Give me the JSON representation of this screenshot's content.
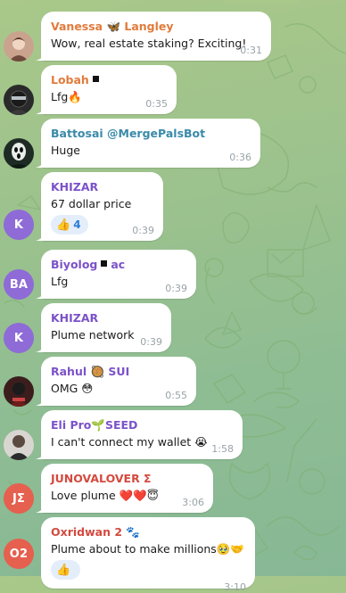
{
  "messages": [
    {
      "sender": "Vanessa 🦋 Langley",
      "text": "Wow, real estate staking? Exciting!",
      "time": "0:31",
      "avatar": "photo",
      "name_color": "#e17b3c"
    },
    {
      "sender": "Lobah",
      "text": "Lfg🔥",
      "time": "0:35",
      "avatar": "photo",
      "name_color": "#e17b3c"
    },
    {
      "sender": "Battosai @MergePalsBot",
      "text": "Huge",
      "time": "0:36",
      "avatar": "photo",
      "name_color": "#3a8aa8"
    },
    {
      "sender": "KHIZAR",
      "text": "67 dollar price",
      "time": "0:39",
      "avatar": "K",
      "avatar_color": "#8e6bd6",
      "name_color": "#7b52c8",
      "reaction": {
        "emoji": "👍",
        "count": "4"
      }
    },
    {
      "sender": "Biyolog",
      "sender_suffix": "ac",
      "text": "Lfg",
      "time": "0:39",
      "avatar": "BA",
      "avatar_color": "#8e6bd6",
      "name_color": "#7b52c8"
    },
    {
      "sender": "KHIZAR",
      "text": "Plume network",
      "time": "0:39",
      "avatar": "K",
      "avatar_color": "#8e6bd6",
      "name_color": "#7b52c8"
    },
    {
      "sender": "Rahul 🥘 SUI",
      "text": "OMG 😳",
      "time": "0:55",
      "avatar": "photo",
      "name_color": "#7b52c8"
    },
    {
      "sender": "Eli Pro🌱SEED",
      "text": "I can't connect my wallet 😭",
      "time": "1:58",
      "avatar": "photo",
      "name_color": "#7b52c8"
    },
    {
      "sender": "JUNOVALOVER Σ",
      "text": "Love plume ❤️❤️😇",
      "time": "3:06",
      "avatar": "JΣ",
      "avatar_color": "#e5604f",
      "name_color": "#d44a3f"
    },
    {
      "sender": "Oxridwan 2 🐾",
      "text": "Plume about to make millions🥹🤝",
      "time": "3:10",
      "avatar": "O2",
      "avatar_color": "#e5604f",
      "name_color": "#d44a3f",
      "reaction": {
        "emoji": "👍",
        "count": ""
      }
    }
  ],
  "colors": {
    "background": "#9cc28d",
    "bubble": "#ffffff",
    "timestamp": "#9aa3a8",
    "reaction_bg": "#e4eefa",
    "reaction_text": "#2c7bd6"
  },
  "icons": [
    "butterfly-icon",
    "fire-icon",
    "thumbs-up-icon",
    "ninja-icon",
    "scream-mask-icon"
  ]
}
